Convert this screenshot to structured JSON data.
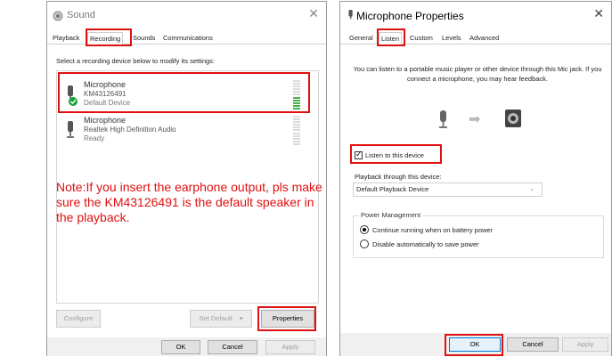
{
  "sound": {
    "title": "Sound",
    "tabs": [
      "Playback",
      "Recording",
      "Sounds",
      "Communications"
    ],
    "instruction": "Select a recording device below to modify its settings:",
    "devices": [
      {
        "name": "Microphone",
        "line1": "KM43126491",
        "line2": "Default Device",
        "level": 0.45
      },
      {
        "name": "Microphone",
        "line1": "Realtek High Definition Audio",
        "line2": "Ready",
        "level": 0
      }
    ],
    "note": "Note:If you insert the earphone output, pls make sure the KM43126491 is the default speaker in the playback.",
    "configure_label": "Configure",
    "set_default_label": "Set Default",
    "properties_label": "Properties",
    "ok_label": "OK",
    "cancel_label": "Cancel",
    "apply_label": "Apply"
  },
  "mic": {
    "title": "Microphone Properties",
    "tabs": [
      "General",
      "Listen",
      "Custom",
      "Levels",
      "Advanced"
    ],
    "description": "You can listen to a portable music player or other device through this Mic jack.  If you connect a microphone, you may hear feedback.",
    "listen_label": "Listen to this device",
    "listen_checked": true,
    "playback_label": "Playback through this device:",
    "playback_value": "Default Playback Device",
    "power_group_label": "Power Management",
    "power_option1": "Continue running when on battery power",
    "power_option2": "Disable automatically to save power",
    "power_selected": 0,
    "ok_label": "OK",
    "cancel_label": "Cancel",
    "apply_label": "Apply"
  },
  "colors": {
    "highlight": "#e01010",
    "meter_on": "#4caf50",
    "meter_off": "#dcdcdc",
    "check": "#1aa33a"
  }
}
